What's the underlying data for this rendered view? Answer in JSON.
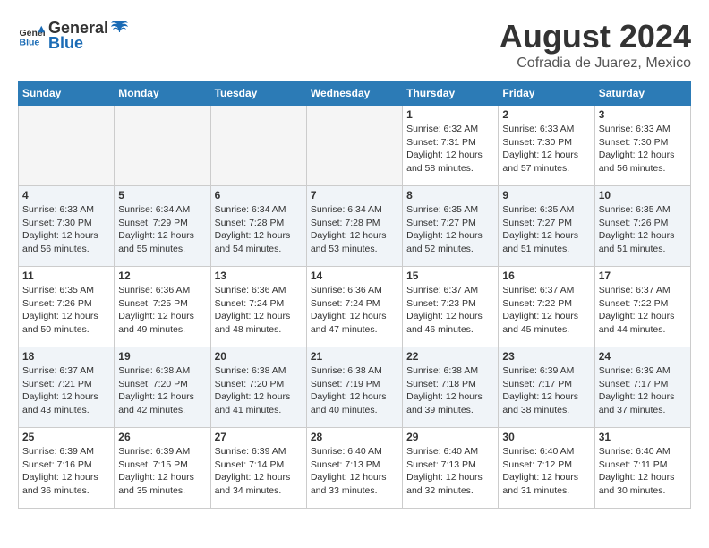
{
  "header": {
    "logo_general": "General",
    "logo_blue": "Blue",
    "month_year": "August 2024",
    "location": "Cofradia de Juarez, Mexico"
  },
  "weekdays": [
    "Sunday",
    "Monday",
    "Tuesday",
    "Wednesday",
    "Thursday",
    "Friday",
    "Saturday"
  ],
  "weeks": [
    [
      {
        "day": "",
        "empty": true
      },
      {
        "day": "",
        "empty": true
      },
      {
        "day": "",
        "empty": true
      },
      {
        "day": "",
        "empty": true
      },
      {
        "day": "1",
        "sunrise": "6:32 AM",
        "sunset": "7:31 PM",
        "daylight": "12 hours and 58 minutes."
      },
      {
        "day": "2",
        "sunrise": "6:33 AM",
        "sunset": "7:30 PM",
        "daylight": "12 hours and 57 minutes."
      },
      {
        "day": "3",
        "sunrise": "6:33 AM",
        "sunset": "7:30 PM",
        "daylight": "12 hours and 56 minutes."
      }
    ],
    [
      {
        "day": "4",
        "sunrise": "6:33 AM",
        "sunset": "7:30 PM",
        "daylight": "12 hours and 56 minutes."
      },
      {
        "day": "5",
        "sunrise": "6:34 AM",
        "sunset": "7:29 PM",
        "daylight": "12 hours and 55 minutes."
      },
      {
        "day": "6",
        "sunrise": "6:34 AM",
        "sunset": "7:28 PM",
        "daylight": "12 hours and 54 minutes."
      },
      {
        "day": "7",
        "sunrise": "6:34 AM",
        "sunset": "7:28 PM",
        "daylight": "12 hours and 53 minutes."
      },
      {
        "day": "8",
        "sunrise": "6:35 AM",
        "sunset": "7:27 PM",
        "daylight": "12 hours and 52 minutes."
      },
      {
        "day": "9",
        "sunrise": "6:35 AM",
        "sunset": "7:27 PM",
        "daylight": "12 hours and 51 minutes."
      },
      {
        "day": "10",
        "sunrise": "6:35 AM",
        "sunset": "7:26 PM",
        "daylight": "12 hours and 51 minutes."
      }
    ],
    [
      {
        "day": "11",
        "sunrise": "6:35 AM",
        "sunset": "7:26 PM",
        "daylight": "12 hours and 50 minutes."
      },
      {
        "day": "12",
        "sunrise": "6:36 AM",
        "sunset": "7:25 PM",
        "daylight": "12 hours and 49 minutes."
      },
      {
        "day": "13",
        "sunrise": "6:36 AM",
        "sunset": "7:24 PM",
        "daylight": "12 hours and 48 minutes."
      },
      {
        "day": "14",
        "sunrise": "6:36 AM",
        "sunset": "7:24 PM",
        "daylight": "12 hours and 47 minutes."
      },
      {
        "day": "15",
        "sunrise": "6:37 AM",
        "sunset": "7:23 PM",
        "daylight": "12 hours and 46 minutes."
      },
      {
        "day": "16",
        "sunrise": "6:37 AM",
        "sunset": "7:22 PM",
        "daylight": "12 hours and 45 minutes."
      },
      {
        "day": "17",
        "sunrise": "6:37 AM",
        "sunset": "7:22 PM",
        "daylight": "12 hours and 44 minutes."
      }
    ],
    [
      {
        "day": "18",
        "sunrise": "6:37 AM",
        "sunset": "7:21 PM",
        "daylight": "12 hours and 43 minutes."
      },
      {
        "day": "19",
        "sunrise": "6:38 AM",
        "sunset": "7:20 PM",
        "daylight": "12 hours and 42 minutes."
      },
      {
        "day": "20",
        "sunrise": "6:38 AM",
        "sunset": "7:20 PM",
        "daylight": "12 hours and 41 minutes."
      },
      {
        "day": "21",
        "sunrise": "6:38 AM",
        "sunset": "7:19 PM",
        "daylight": "12 hours and 40 minutes."
      },
      {
        "day": "22",
        "sunrise": "6:38 AM",
        "sunset": "7:18 PM",
        "daylight": "12 hours and 39 minutes."
      },
      {
        "day": "23",
        "sunrise": "6:39 AM",
        "sunset": "7:17 PM",
        "daylight": "12 hours and 38 minutes."
      },
      {
        "day": "24",
        "sunrise": "6:39 AM",
        "sunset": "7:17 PM",
        "daylight": "12 hours and 37 minutes."
      }
    ],
    [
      {
        "day": "25",
        "sunrise": "6:39 AM",
        "sunset": "7:16 PM",
        "daylight": "12 hours and 36 minutes."
      },
      {
        "day": "26",
        "sunrise": "6:39 AM",
        "sunset": "7:15 PM",
        "daylight": "12 hours and 35 minutes."
      },
      {
        "day": "27",
        "sunrise": "6:39 AM",
        "sunset": "7:14 PM",
        "daylight": "12 hours and 34 minutes."
      },
      {
        "day": "28",
        "sunrise": "6:40 AM",
        "sunset": "7:13 PM",
        "daylight": "12 hours and 33 minutes."
      },
      {
        "day": "29",
        "sunrise": "6:40 AM",
        "sunset": "7:13 PM",
        "daylight": "12 hours and 32 minutes."
      },
      {
        "day": "30",
        "sunrise": "6:40 AM",
        "sunset": "7:12 PM",
        "daylight": "12 hours and 31 minutes."
      },
      {
        "day": "31",
        "sunrise": "6:40 AM",
        "sunset": "7:11 PM",
        "daylight": "12 hours and 30 minutes."
      }
    ]
  ]
}
